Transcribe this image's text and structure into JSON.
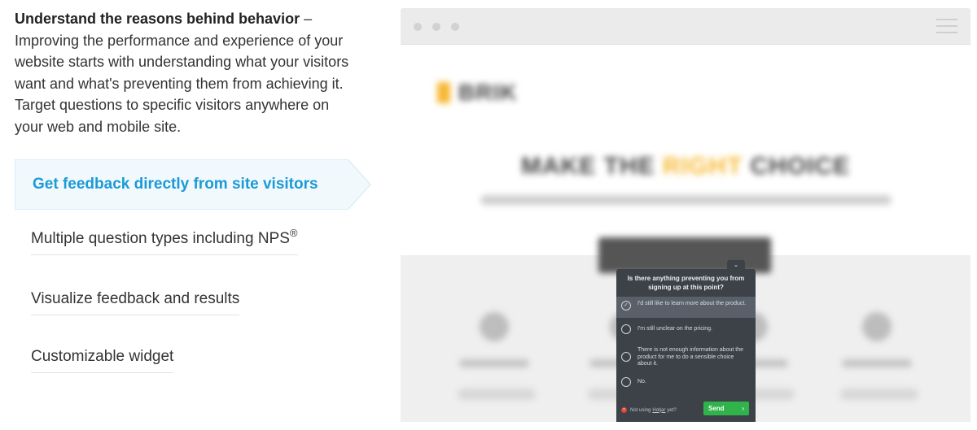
{
  "intro": {
    "title": "Understand the reasons behind behavior",
    "dash": " – ",
    "body": "Improving the performance and experience of your website starts with understanding what your visitors want and what's preventing them from achieving it. Target questions to specific visitors anywhere on your web and mobile site."
  },
  "tabs": [
    {
      "label": "Get feedback directly from site visitors",
      "active": true
    },
    {
      "label": "Multiple question types including NPS",
      "sup": "®",
      "active": false
    },
    {
      "label": "Visualize feedback and results",
      "active": false
    },
    {
      "label": "Customizable widget",
      "active": false
    }
  ],
  "colors": {
    "accent": "#1b9ad6",
    "widget_bg": "#3c4248",
    "send_green": "#2fb34a",
    "brand_yellow": "#f7b731"
  },
  "widget": {
    "question": "Is there anything preventing you from signing up at this point?",
    "options": [
      {
        "label": "I'd still like to learn more about the product.",
        "selected": true
      },
      {
        "label": "I'm still unclear on the pricing.",
        "selected": false
      },
      {
        "label": "There is not enough information about the product for me to do a sensible choice about it.",
        "selected": false
      },
      {
        "label": "No.",
        "selected": false
      }
    ],
    "footer_prefix": "Not using",
    "footer_brand": "Hotjar",
    "footer_suffix": "yet?",
    "send_label": "Send",
    "send_icon": "›",
    "check_icon": "✓",
    "collapse_icon": "⌄"
  },
  "icons": [
    "window-dot-icon",
    "hamburger-menu-icon",
    "check-icon",
    "chevron-right-icon",
    "collapse-chevron-icon",
    "close-icon"
  ]
}
